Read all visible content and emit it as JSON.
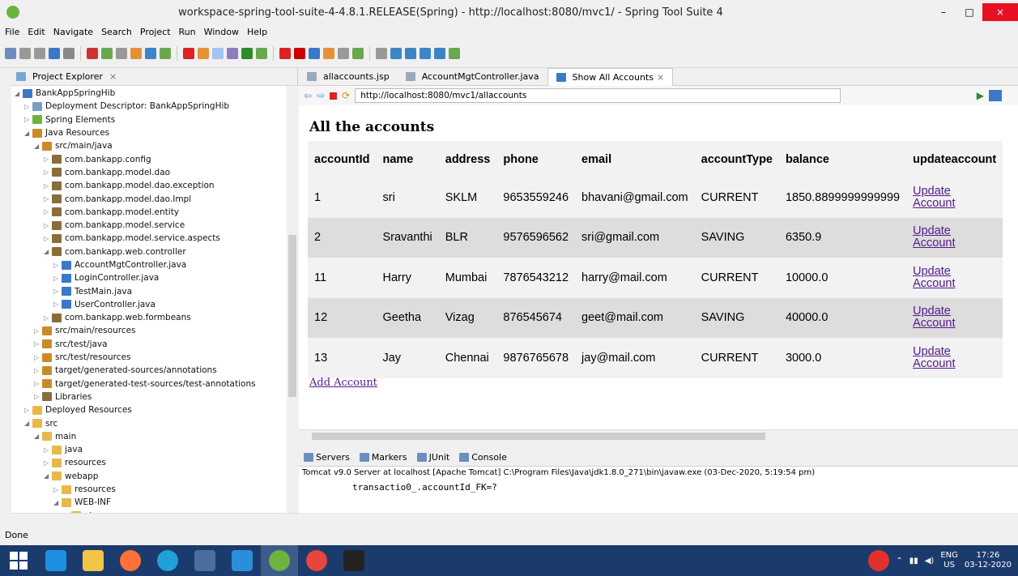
{
  "window": {
    "title": "workspace-spring-tool-suite-4-4.8.1.RELEASE(Spring) - http://localhost:8080/mvc1/ - Spring Tool Suite 4",
    "minimize": "–",
    "maximize": "□",
    "close": "×"
  },
  "menu": [
    "File",
    "Edit",
    "Navigate",
    "Search",
    "Project",
    "Run",
    "Window",
    "Help"
  ],
  "explorer": {
    "title": "Project Explorer",
    "items": [
      {
        "label": "BankAppSpringHib",
        "depth": 0,
        "icon": "project",
        "open": true
      },
      {
        "label": "Deployment Descriptor: BankAppSpringHib",
        "depth": 1,
        "icon": "descriptor"
      },
      {
        "label": "Spring Elements",
        "depth": 1,
        "icon": "spring"
      },
      {
        "label": "Java Resources",
        "depth": 1,
        "icon": "jres",
        "open": true
      },
      {
        "label": "src/main/java",
        "depth": 2,
        "icon": "srcfolder",
        "open": true
      },
      {
        "label": "com.bankapp.config",
        "depth": 3,
        "icon": "package"
      },
      {
        "label": "com.bankapp.model.dao",
        "depth": 3,
        "icon": "package"
      },
      {
        "label": "com.bankapp.model.dao.exception",
        "depth": 3,
        "icon": "package"
      },
      {
        "label": "com.bankapp.model.dao.Impl",
        "depth": 3,
        "icon": "package"
      },
      {
        "label": "com.bankapp.model.entity",
        "depth": 3,
        "icon": "package"
      },
      {
        "label": "com.bankapp.model.service",
        "depth": 3,
        "icon": "package"
      },
      {
        "label": "com.bankapp.model.service.aspects",
        "depth": 3,
        "icon": "package"
      },
      {
        "label": "com.bankapp.web.controller",
        "depth": 3,
        "icon": "package",
        "open": true
      },
      {
        "label": "AccountMgtController.java",
        "depth": 4,
        "icon": "javafile"
      },
      {
        "label": "LoginController.java",
        "depth": 4,
        "icon": "javafile"
      },
      {
        "label": "TestMain.java",
        "depth": 4,
        "icon": "javafile"
      },
      {
        "label": "UserController.java",
        "depth": 4,
        "icon": "javafile"
      },
      {
        "label": "com.bankapp.web.formbeans",
        "depth": 3,
        "icon": "package"
      },
      {
        "label": "src/main/resources",
        "depth": 2,
        "icon": "srcfolder"
      },
      {
        "label": "src/test/java",
        "depth": 2,
        "icon": "srcfolder"
      },
      {
        "label": "src/test/resources",
        "depth": 2,
        "icon": "srcfolder"
      },
      {
        "label": "target/generated-sources/annotations",
        "depth": 2,
        "icon": "srcfolder"
      },
      {
        "label": "target/generated-test-sources/test-annotations",
        "depth": 2,
        "icon": "srcfolder"
      },
      {
        "label": "Libraries",
        "depth": 2,
        "icon": "library"
      },
      {
        "label": "Deployed Resources",
        "depth": 1,
        "icon": "folder"
      },
      {
        "label": "src",
        "depth": 1,
        "icon": "folder",
        "open": true
      },
      {
        "label": "main",
        "depth": 2,
        "icon": "folder",
        "open": true
      },
      {
        "label": "java",
        "depth": 3,
        "icon": "folder"
      },
      {
        "label": "resources",
        "depth": 3,
        "icon": "folder"
      },
      {
        "label": "webapp",
        "depth": 3,
        "icon": "folder",
        "open": true
      },
      {
        "label": "resources",
        "depth": 4,
        "icon": "folder"
      },
      {
        "label": "WEB-INF",
        "depth": 4,
        "icon": "folder",
        "open": true
      },
      {
        "label": "views",
        "depth": 5,
        "icon": "folder"
      }
    ]
  },
  "tabs": [
    {
      "label": "allaccounts.jsp",
      "active": false
    },
    {
      "label": "AccountMgtController.java",
      "active": false
    },
    {
      "label": "Show All Accounts",
      "active": true
    }
  ],
  "browser": {
    "url": "http://localhost:8080/mvc1/allaccounts",
    "heading": "All the accounts",
    "columns": [
      "accountId",
      "name",
      "address",
      "phone",
      "email",
      "accountType",
      "balance",
      "updateaccount"
    ],
    "rows": [
      [
        "1",
        "sri",
        "SKLM",
        "9653559246",
        "bhavani@gmail.com",
        "CURRENT",
        "1850.8899999999999"
      ],
      [
        "2",
        "Sravanthi",
        "BLR",
        "9576596562",
        "sri@gmail.com",
        "SAVING",
        "6350.9"
      ],
      [
        "11",
        "Harry",
        "Mumbai",
        "7876543212",
        "harry@mail.com",
        "CURRENT",
        "10000.0"
      ],
      [
        "12",
        "Geetha",
        "Vizag",
        "876545674",
        "geet@mail.com",
        "SAVING",
        "40000.0"
      ],
      [
        "13",
        "Jay",
        "Chennai",
        "9876765678",
        "jay@mail.com",
        "CURRENT",
        "3000.0"
      ]
    ],
    "update_link_1": "Update",
    "update_link_2": "Account",
    "add_link": "Add Account"
  },
  "console": {
    "tabs": [
      "Servers",
      "Markers",
      "JUnit",
      "Console"
    ],
    "server_line": "Tomcat v9.0 Server at localhost [Apache Tomcat] C:\\Program Files\\Java\\jdk1.8.0_271\\bin\\javaw.exe  (03-Dec-2020, 5:19:54 pm)",
    "output": "transactio0_.accountId_FK=?"
  },
  "status": {
    "text": "Done"
  },
  "taskbar": {
    "lang": "ENG",
    "region": "US",
    "time": "17:26",
    "date": "03-12-2020"
  },
  "colors": {
    "accent": "#e81123",
    "taskbar": "#1c3b6d",
    "link": "#551a8b"
  }
}
